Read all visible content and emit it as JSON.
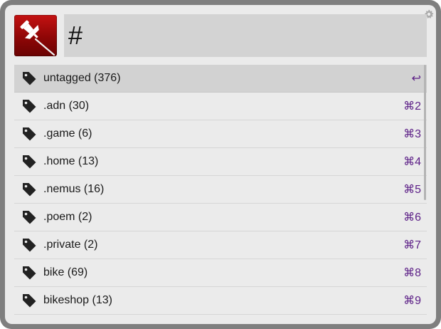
{
  "query": {
    "value": "#"
  },
  "results": [
    {
      "label": "untagged (376)",
      "shortcut": "↩",
      "selected": true
    },
    {
      "label": ".adn (30)",
      "shortcut": "⌘2"
    },
    {
      "label": ".game (6)",
      "shortcut": "⌘3"
    },
    {
      "label": ".home (13)",
      "shortcut": "⌘4"
    },
    {
      "label": ".nemus (16)",
      "shortcut": "⌘5"
    },
    {
      "label": ".poem (2)",
      "shortcut": "⌘6"
    },
    {
      "label": ".private (2)",
      "shortcut": "⌘7"
    },
    {
      "label": "bike (69)",
      "shortcut": "⌘8"
    },
    {
      "label": "bikeshop (13)",
      "shortcut": "⌘9"
    }
  ],
  "icons": {
    "app": "pushpin-icon",
    "row": "tag-icon",
    "settings": "gear-icon"
  },
  "colors": {
    "frame": "#7f7f7f",
    "panel": "#ebebeb",
    "query_background": "#d3d3d3",
    "selected_row": "#d2d2d2",
    "shortcut_text": "#5b1e86",
    "app_icon": "#b00d0d"
  }
}
